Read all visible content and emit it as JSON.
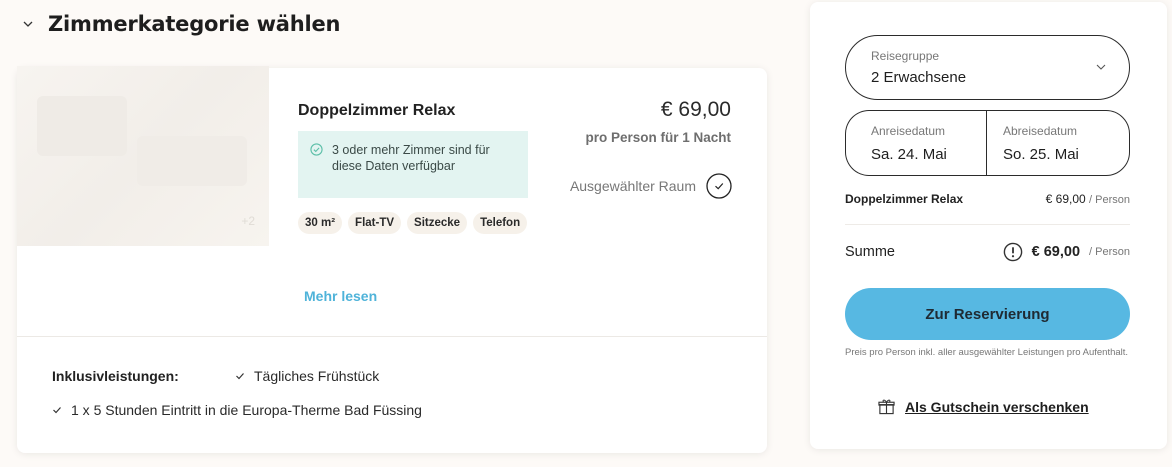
{
  "section": {
    "title": "Zimmerkategorie wählen",
    "icon": "chevron-down-icon"
  },
  "room": {
    "title": "Doppelzimmer Relax",
    "image_count": "+2",
    "availability": "3 oder mehr Zimmer sind für diese Daten verfügbar",
    "tags": [
      "30 m²",
      "Flat-TV",
      "Sitzecke",
      "Telefon"
    ],
    "more_link": "Mehr lesen",
    "price": "€ 69,00",
    "price_note": "pro Person für 1 Nacht",
    "selected_label": "Ausgewählter Raum",
    "inclusions_label": "Inklusivleistungen:",
    "inclusions": [
      "Tägliches Frühstück",
      "1 x 5 Stunden Eintritt in die Europa-Therme Bad Füssing"
    ]
  },
  "booking": {
    "group_label": "Reisegruppe",
    "group_value": "2 Erwachsene",
    "arrival_label": "Anreisedatum",
    "arrival_value": "Sa. 24. Mai",
    "departure_label": "Abreisedatum",
    "departure_value": "So. 25. Mai",
    "line_item_name": "Doppelzimmer Relax",
    "line_item_price": "€ 69,00",
    "per_person": "/ Person",
    "total_label": "Summe",
    "total_price": "€ 69,00",
    "cta_label": "Zur Reservierung",
    "fineprint": "Preis pro Person inkl. aller ausgewählter Leistungen pro Aufenthalt.",
    "gift_link": "Als Gutschein verschenken"
  },
  "colors": {
    "accent": "#57b8e2",
    "link": "#4fb3d9",
    "availability_bg": "#e3f4f1",
    "page_bg": "#fdfaf7"
  }
}
